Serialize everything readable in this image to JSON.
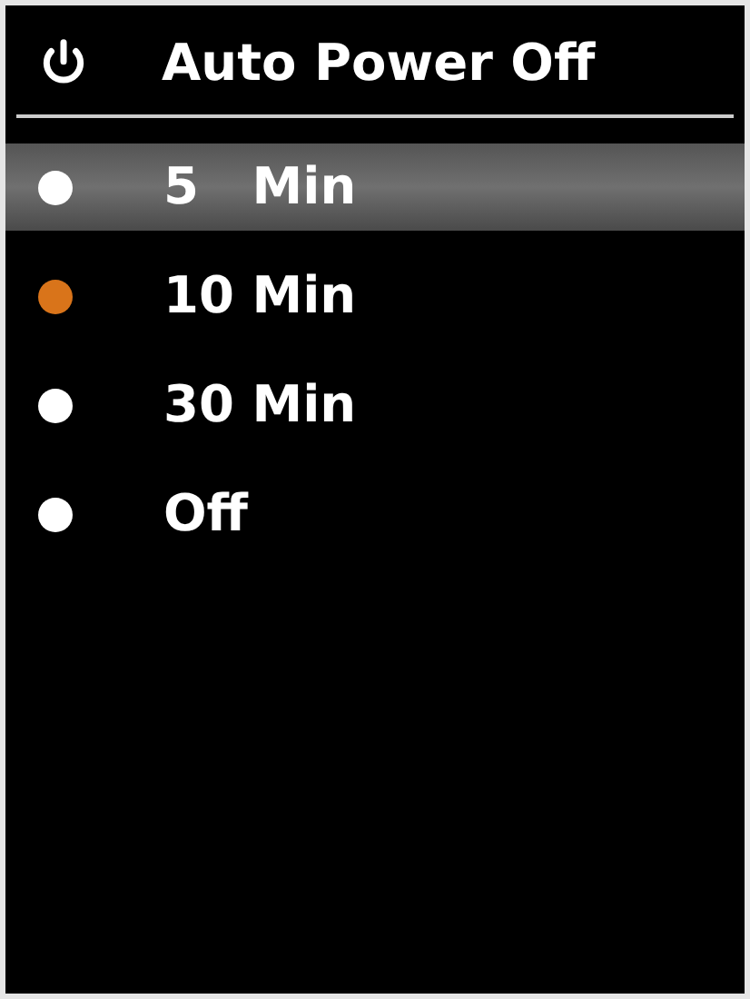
{
  "header": {
    "title": "Auto Power Off"
  },
  "options": [
    {
      "label": "5   Min",
      "highlighted": true,
      "selected": false
    },
    {
      "label": "10 Min",
      "highlighted": false,
      "selected": true
    },
    {
      "label": "30 Min",
      "highlighted": false,
      "selected": false
    },
    {
      "label": "Off",
      "highlighted": false,
      "selected": false
    }
  ]
}
